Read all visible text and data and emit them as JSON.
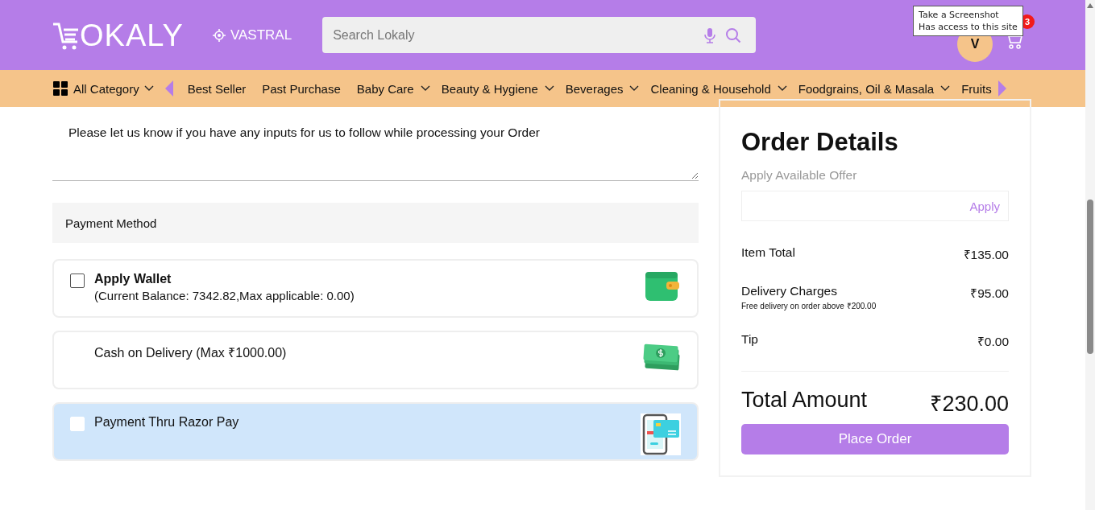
{
  "header": {
    "logo": "OKALY",
    "location": "VASTRAL",
    "search": {
      "placeholder": "Search Lokaly"
    },
    "avatar": "V",
    "cart_count": "3"
  },
  "tooltip": {
    "lines": [
      "Take a Screenshot",
      "Has access to this site"
    ]
  },
  "nav": {
    "all_category": "All Category",
    "items": [
      {
        "label": "Best Seller",
        "dropdown": false
      },
      {
        "label": "Past Purchase",
        "dropdown": false
      },
      {
        "label": "Baby Care",
        "dropdown": true
      },
      {
        "label": "Beauty & Hygiene",
        "dropdown": true
      },
      {
        "label": "Beverages",
        "dropdown": true
      },
      {
        "label": "Cleaning & Household",
        "dropdown": true
      },
      {
        "label": "Foodgrains, Oil & Masala",
        "dropdown": true
      },
      {
        "label": "Fruits",
        "dropdown": false
      }
    ]
  },
  "instructions": {
    "placeholder": "Please let us know if you have any inputs for us to follow while processing your Order"
  },
  "payment": {
    "heading": "Payment Method",
    "options": [
      {
        "kind": "wallet",
        "title": "Apply Wallet",
        "subtitle": "(Current Balance: 7342.82,Max applicable: 0.00)",
        "checked": false,
        "selected": false
      },
      {
        "kind": "cash",
        "title": "Cash on Delivery (Max ₹1000.00)",
        "selected": false
      },
      {
        "kind": "card",
        "title": "Payment Thru Razor Pay",
        "checked": false,
        "selected": true
      }
    ]
  },
  "order": {
    "title": "Order Details",
    "offer_label": "Apply Available Offer",
    "apply": "Apply",
    "lines": [
      {
        "label": "Item Total",
        "amount": "₹135.00"
      },
      {
        "label": "Delivery Charges",
        "note": "Free delivery on order above ₹200.00",
        "amount": "₹95.00"
      },
      {
        "label": "Tip",
        "amount": "₹0.00"
      }
    ],
    "total_label": "Total Amount",
    "total": "₹230.00",
    "button": "Place Order"
  }
}
